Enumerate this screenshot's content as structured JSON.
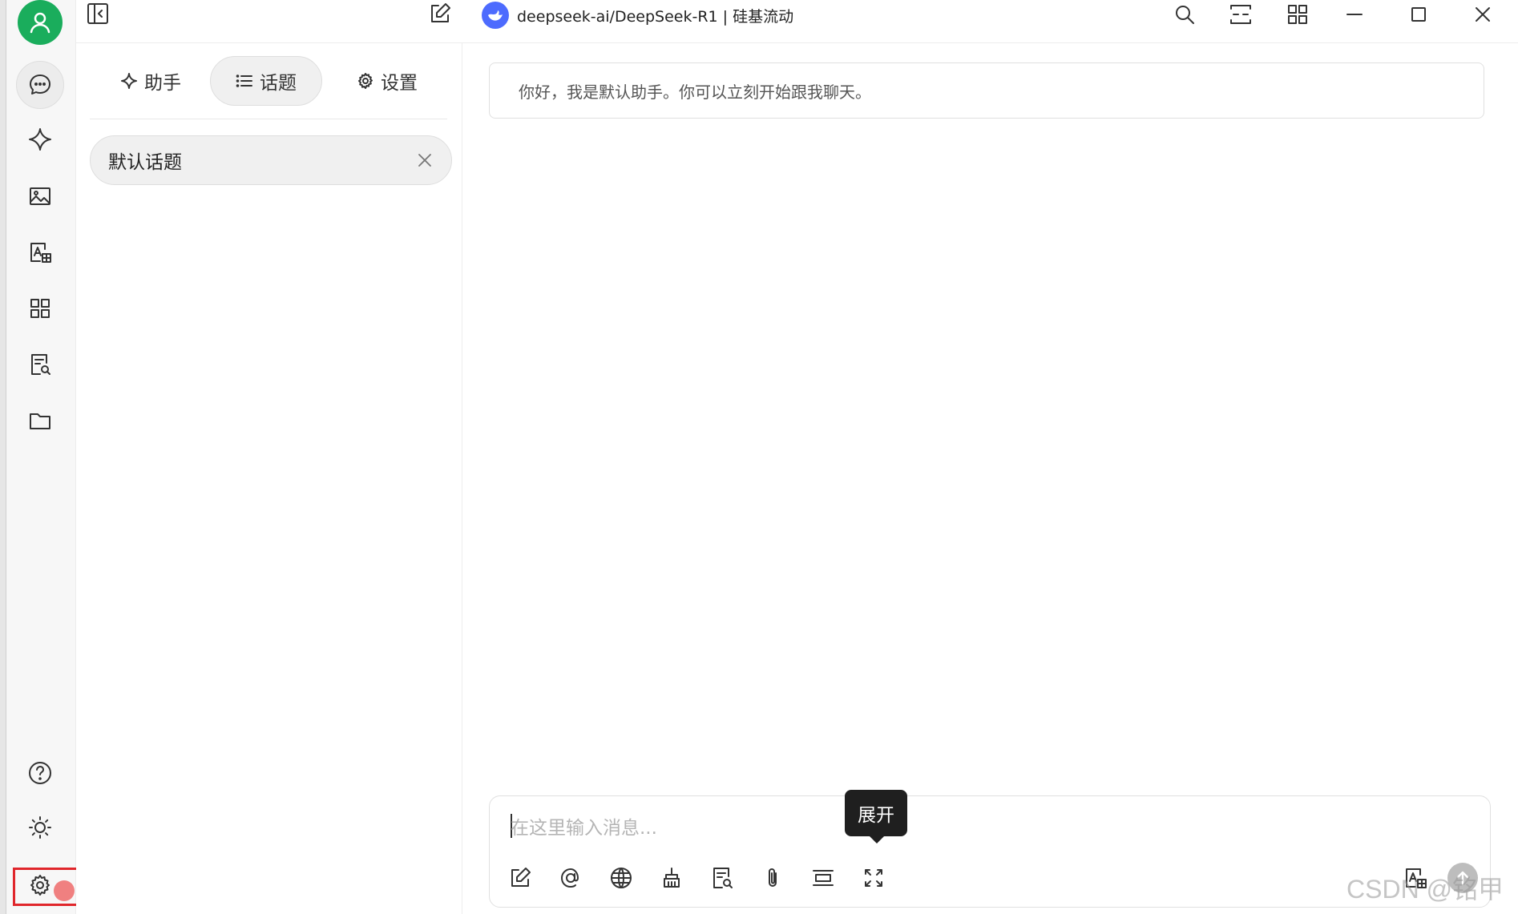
{
  "window": {
    "title": "deepseek-ai/DeepSeek-R1 | 硅基流动"
  },
  "panel": {
    "tabs": [
      {
        "label": "助手",
        "icon": "sparkle-icon"
      },
      {
        "label": "话题",
        "icon": "list-icon"
      },
      {
        "label": "设置",
        "icon": "gear-icon"
      }
    ],
    "active_tab": "话题",
    "topics": [
      {
        "label": "默认话题"
      }
    ]
  },
  "chat": {
    "greeting": "你好，我是默认助手。你可以立刻开始跟我聊天。",
    "input_placeholder": "在这里输入消息...",
    "tooltip": "展开"
  },
  "watermark": "CSDN @铭甲",
  "colors": {
    "avatar_green": "#1aad5c",
    "highlight_red": "#e0262b",
    "notification_dot": "#f08080",
    "logo_blue": "#4d6bfe"
  }
}
